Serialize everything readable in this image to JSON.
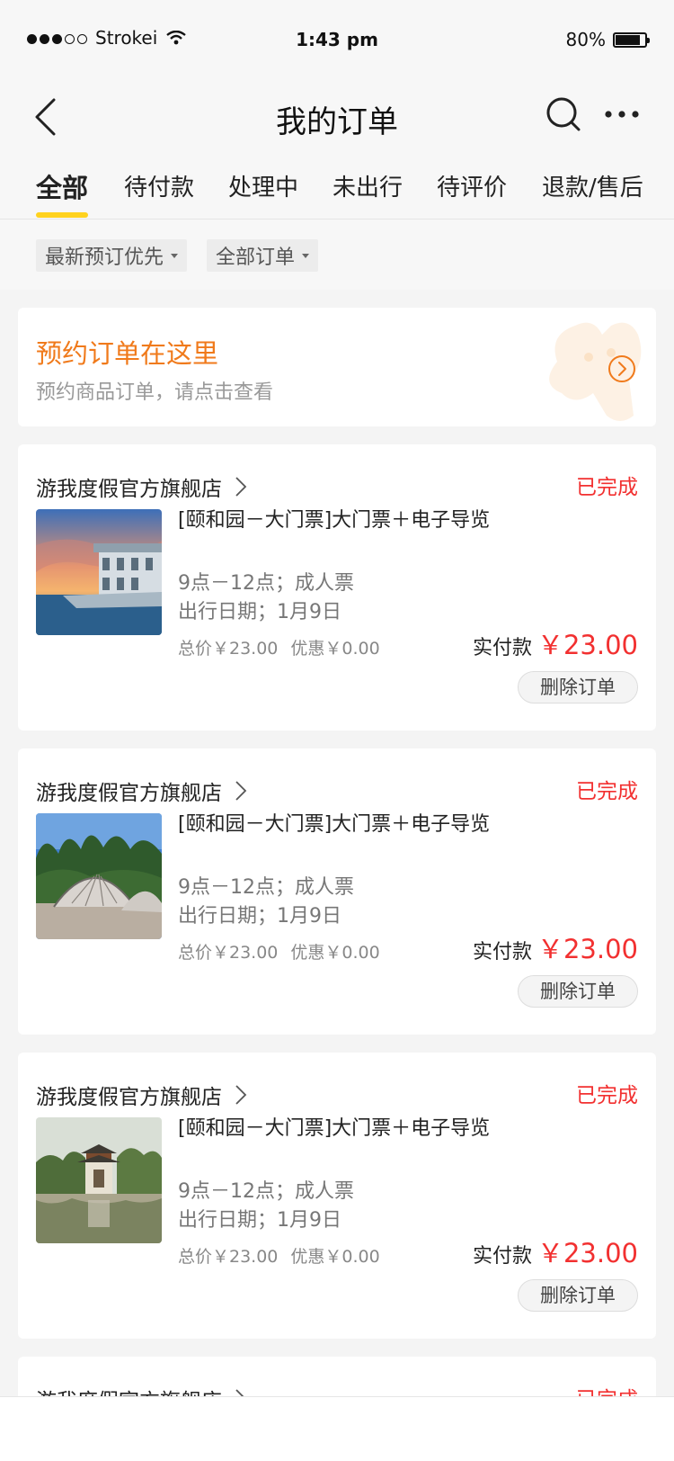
{
  "status_bar": {
    "carrier": "Strokei",
    "time": "1:43 pm",
    "battery": "80%",
    "battery_level": 0.8
  },
  "nav": {
    "title": "我的订单"
  },
  "tabs": [
    {
      "label": "全部",
      "active": true
    },
    {
      "label": "待付款"
    },
    {
      "label": "处理中"
    },
    {
      "label": "未出行"
    },
    {
      "label": "待评价"
    },
    {
      "label": "退款/售后"
    }
  ],
  "filters": [
    {
      "label": "最新预订优先"
    },
    {
      "label": "全部订单"
    }
  ],
  "promo": {
    "title": "预约订单在这里",
    "subtitle": "预约商品订单，请点击查看",
    "accent": "#f07a1b"
  },
  "orders": [
    {
      "store": "游我度假官方旗舰店",
      "status": "已完成",
      "title": "[颐和园－大门票]大门票＋电子导览",
      "spec": "9点－12点；成人票",
      "date": "出行日期；1月9日",
      "total": "总价￥23.00",
      "discount": "优惠￥0.00",
      "paid_label": "实付款",
      "paid_amount": "￥23.00",
      "delete_label": "删除订单",
      "image": "marble-boat-sunset"
    },
    {
      "store": "游我度假官方旗舰店",
      "status": "已完成",
      "title": "[颐和园－大门票]大门票＋电子导览",
      "spec": "9点－12点；成人票",
      "date": "出行日期；1月9日",
      "total": "总价￥23.00",
      "discount": "优惠￥0.00",
      "paid_label": "实付款",
      "paid_amount": "￥23.00",
      "delete_label": "删除订单",
      "image": "fan-sculpture-garden"
    },
    {
      "store": "游我度假官方旗舰店",
      "status": "已完成",
      "title": "[颐和园－大门票]大门票＋电子导览",
      "spec": "9点－12点；成人票",
      "date": "出行日期；1月9日",
      "total": "总价￥23.00",
      "discount": "优惠￥0.00",
      "paid_label": "实付款",
      "paid_amount": "￥23.00",
      "delete_label": "删除订单",
      "image": "pavilion-lake"
    },
    {
      "store": "游我度假官方旗舰店",
      "status": "已完成"
    }
  ],
  "colors": {
    "status_red": "#f23030",
    "tab_indicator": "#ffd21e"
  }
}
